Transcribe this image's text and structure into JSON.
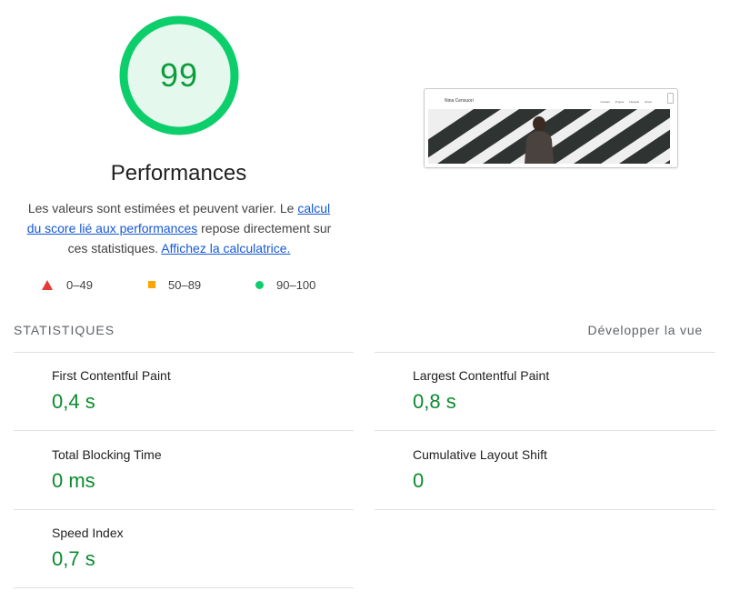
{
  "gauge": {
    "score": "99",
    "title": "Performances",
    "colors": {
      "ring": "#0cce6b",
      "fill": "#e5f8ee",
      "text": "#0c9c3a"
    }
  },
  "description": {
    "text1": "Les valeurs sont estimées et peuvent varier. Le ",
    "link1": "calcul du score lié aux performances",
    "text2": " repose directement sur ces statistiques. ",
    "link2": "Affichez la calculatrice."
  },
  "legend": {
    "fail": "0–49",
    "average": "50–89",
    "pass": "90–100",
    "colors": {
      "fail": "#e53935",
      "average": "#ffa400",
      "pass": "#0cce6b"
    }
  },
  "preview": {
    "site_name": "Nina Censuori",
    "nav": [
      "Contact",
      "Projets",
      "Lifestyle",
      "About"
    ]
  },
  "metrics": {
    "section_title": "STATISTIQUES",
    "toggle_label": "Développer la vue",
    "items": [
      {
        "name": "First Contentful Paint",
        "value": "0,4 s"
      },
      {
        "name": "Largest Contentful Paint",
        "value": "0,8 s"
      },
      {
        "name": "Total Blocking Time",
        "value": "0 ms"
      },
      {
        "name": "Cumulative Layout Shift",
        "value": "0"
      },
      {
        "name": "Speed Index",
        "value": "0,7 s"
      }
    ]
  }
}
